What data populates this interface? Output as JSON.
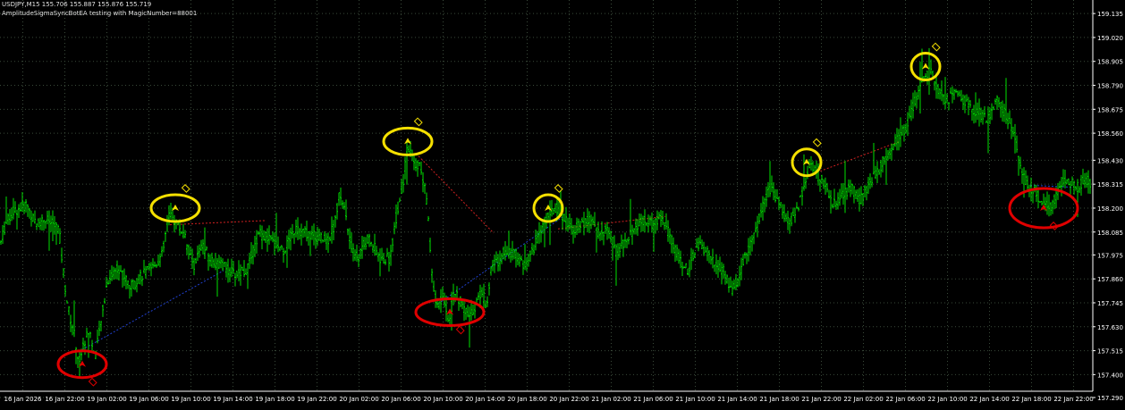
{
  "header": {
    "symbol_line": "USDJPY,M15  155.706 155.887 155.876 155.719",
    "ea_line": "AmplitudeSigmaSyncBotEA testing with MagicNumber=88001"
  },
  "colors": {
    "background": "#000000",
    "candle": "#00e000",
    "grid": "#3a4a3a",
    "axis_text": "#ffffff",
    "highlight_yellow": "#f5e000",
    "highlight_red": "#e00000",
    "arrow_buy": "#f5e000",
    "arrow_sell": "#e00000"
  },
  "chart_data": {
    "type": "candlestick",
    "symbol": "USDJPY",
    "timeframe": "M15",
    "ylim": [
      157.32,
      159.2
    ],
    "y_ticks": [
      159.135,
      159.02,
      158.905,
      158.79,
      158.675,
      158.56,
      158.43,
      158.315,
      158.2,
      158.085,
      157.975,
      157.86,
      157.745,
      157.63,
      157.515,
      157.4,
      157.29
    ],
    "x_ticks": [
      "16 Jan 2026",
      "16 Jan 22:00",
      "19 Jan 02:00",
      "19 Jan 06:00",
      "19 Jan 10:00",
      "19 Jan 14:00",
      "19 Jan 18:00",
      "19 Jan 22:00",
      "20 Jan 02:00",
      "20 Jan 06:00",
      "20 Jan 10:00",
      "20 Jan 14:00",
      "20 Jan 18:00",
      "20 Jan 22:00",
      "21 Jan 02:00",
      "21 Jan 06:00",
      "21 Jan 10:00",
      "21 Jan 14:00",
      "21 Jan 18:00",
      "21 Jan 22:00",
      "22 Jan 02:00",
      "22 Jan 06:00",
      "22 Jan 10:00",
      "22 Jan 14:00",
      "22 Jan 18:00",
      "22 Jan 22:00"
    ],
    "price_path": [
      [
        0,
        158.02
      ],
      [
        6,
        158.12
      ],
      [
        14,
        158.18
      ],
      [
        22,
        158.2
      ],
      [
        30,
        158.22
      ],
      [
        40,
        158.12
      ],
      [
        50,
        158.15
      ],
      [
        60,
        158.12
      ],
      [
        66,
        158.1
      ],
      [
        70,
        157.92
      ],
      [
        76,
        157.72
      ],
      [
        82,
        157.62
      ],
      [
        88,
        157.46
      ],
      [
        94,
        157.55
      ],
      [
        100,
        157.62
      ],
      [
        106,
        157.48
      ],
      [
        112,
        157.62
      ],
      [
        120,
        157.85
      ],
      [
        132,
        157.92
      ],
      [
        146,
        157.82
      ],
      [
        160,
        157.88
      ],
      [
        172,
        157.92
      ],
      [
        182,
        157.98
      ],
      [
        188,
        158.16
      ],
      [
        196,
        158.14
      ],
      [
        206,
        158.07
      ],
      [
        216,
        157.92
      ],
      [
        226,
        158.02
      ],
      [
        236,
        157.95
      ],
      [
        250,
        157.92
      ],
      [
        262,
        157.88
      ],
      [
        276,
        157.9
      ],
      [
        290,
        158.08
      ],
      [
        304,
        158.04
      ],
      [
        318,
        158.0
      ],
      [
        330,
        158.1
      ],
      [
        342,
        158.08
      ],
      [
        356,
        158.06
      ],
      [
        366,
        158.04
      ],
      [
        374,
        158.12
      ],
      [
        380,
        158.28
      ],
      [
        386,
        158.18
      ],
      [
        392,
        158.02
      ],
      [
        400,
        157.96
      ],
      [
        412,
        158.06
      ],
      [
        426,
        157.95
      ],
      [
        436,
        157.96
      ],
      [
        444,
        158.18
      ],
      [
        450,
        158.3
      ],
      [
        456,
        158.5
      ],
      [
        462,
        158.42
      ],
      [
        470,
        158.4
      ],
      [
        478,
        158.22
      ],
      [
        484,
        157.82
      ],
      [
        490,
        157.72
      ],
      [
        496,
        157.78
      ],
      [
        502,
        157.66
      ],
      [
        508,
        157.8
      ],
      [
        514,
        157.76
      ],
      [
        520,
        157.7
      ],
      [
        526,
        157.68
      ],
      [
        532,
        157.74
      ],
      [
        538,
        157.8
      ],
      [
        544,
        157.74
      ],
      [
        550,
        157.92
      ],
      [
        558,
        157.95
      ],
      [
        566,
        158.0
      ],
      [
        576,
        157.98
      ],
      [
        586,
        157.92
      ],
      [
        596,
        158.0
      ],
      [
        604,
        158.08
      ],
      [
        612,
        158.16
      ],
      [
        622,
        158.2
      ],
      [
        630,
        158.16
      ],
      [
        640,
        158.1
      ],
      [
        650,
        158.12
      ],
      [
        660,
        158.14
      ],
      [
        670,
        158.08
      ],
      [
        680,
        158.1
      ],
      [
        690,
        157.98
      ],
      [
        700,
        158.04
      ],
      [
        710,
        158.1
      ],
      [
        720,
        158.14
      ],
      [
        730,
        158.12
      ],
      [
        740,
        158.16
      ],
      [
        750,
        158.06
      ],
      [
        760,
        157.95
      ],
      [
        770,
        157.9
      ],
      [
        780,
        158.02
      ],
      [
        790,
        158.0
      ],
      [
        800,
        157.92
      ],
      [
        810,
        157.9
      ],
      [
        818,
        157.8
      ],
      [
        826,
        157.86
      ],
      [
        834,
        157.98
      ],
      [
        844,
        158.08
      ],
      [
        854,
        158.22
      ],
      [
        862,
        158.3
      ],
      [
        872,
        158.22
      ],
      [
        882,
        158.12
      ],
      [
        892,
        158.2
      ],
      [
        900,
        158.32
      ],
      [
        906,
        158.42
      ],
      [
        914,
        158.36
      ],
      [
        922,
        158.32
      ],
      [
        932,
        158.22
      ],
      [
        942,
        158.26
      ],
      [
        952,
        158.3
      ],
      [
        962,
        158.24
      ],
      [
        972,
        158.32
      ],
      [
        982,
        158.38
      ],
      [
        992,
        158.46
      ],
      [
        1002,
        158.52
      ],
      [
        1012,
        158.58
      ],
      [
        1022,
        158.7
      ],
      [
        1032,
        158.82
      ],
      [
        1040,
        158.86
      ],
      [
        1048,
        158.78
      ],
      [
        1058,
        158.72
      ],
      [
        1070,
        158.76
      ],
      [
        1082,
        158.7
      ],
      [
        1094,
        158.66
      ],
      [
        1104,
        158.62
      ],
      [
        1114,
        158.72
      ],
      [
        1124,
        158.66
      ],
      [
        1134,
        158.56
      ],
      [
        1142,
        158.38
      ],
      [
        1150,
        158.3
      ],
      [
        1158,
        158.28
      ],
      [
        1166,
        158.22
      ],
      [
        1176,
        158.2
      ],
      [
        1186,
        158.32
      ],
      [
        1196,
        158.34
      ],
      [
        1206,
        158.3
      ],
      [
        1214,
        158.34
      ],
      [
        1220,
        158.32
      ]
    ],
    "highlight_circles": [
      {
        "color": "yellow",
        "x_at": 196,
        "y": 158.2
      },
      {
        "color": "yellow",
        "x_at": 456,
        "y": 158.52
      },
      {
        "color": "yellow",
        "x_at": 613,
        "y": 158.2
      },
      {
        "color": "yellow",
        "x_at": 902,
        "y": 158.42
      },
      {
        "color": "yellow",
        "x_at": 1035,
        "y": 158.88
      },
      {
        "color": "red",
        "x_at": 92,
        "y": 157.45
      },
      {
        "color": "red",
        "x_at": 503,
        "y": 157.7
      },
      {
        "color": "red",
        "x_at": 1167,
        "y": 158.2
      }
    ],
    "trade_lines": [
      {
        "color": "red",
        "from": [
          190,
          158.12
        ],
        "to": [
          296,
          158.14
        ]
      },
      {
        "color": "red",
        "from": [
          468,
          158.45
        ],
        "to": [
          552,
          158.08
        ]
      },
      {
        "color": "red",
        "from": [
          624,
          158.1
        ],
        "to": [
          744,
          158.16
        ]
      },
      {
        "color": "red",
        "from": [
          906,
          158.36
        ],
        "to": [
          1006,
          158.52
        ]
      },
      {
        "color": "blue",
        "from": [
          92,
          157.52
        ],
        "to": [
          250,
          157.9
        ]
      },
      {
        "color": "blue",
        "from": [
          490,
          157.74
        ],
        "to": [
          630,
          158.16
        ]
      },
      {
        "color": "blue",
        "from": [
          1152,
          158.31
        ],
        "to": [
          1200,
          158.3
        ]
      }
    ]
  }
}
